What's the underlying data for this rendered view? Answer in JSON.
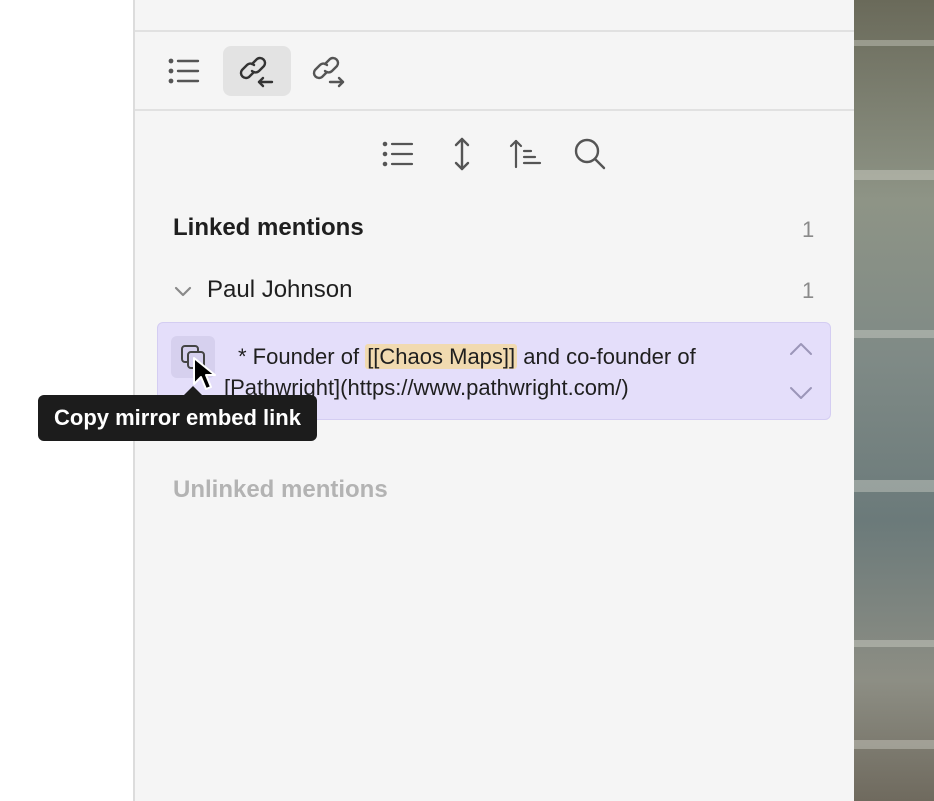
{
  "tabs": [
    {
      "icon": "outline-icon",
      "active": false
    },
    {
      "icon": "backlinks-icon",
      "active": true
    },
    {
      "icon": "outgoing-links-icon",
      "active": false
    }
  ],
  "tools": [
    "list-icon",
    "expand-collapse-icon",
    "sort-icon",
    "search-icon"
  ],
  "linked": {
    "title": "Linked mentions",
    "count": "1",
    "groups": [
      {
        "name": "Paul Johnson",
        "count": "1",
        "mention": {
          "prefix": "* Founder of ",
          "highlight": "[[Chaos Maps]]",
          "middle": " and co-founder of",
          "suffix": "[Pathwright](https://www.pathwright.com/)"
        }
      }
    ]
  },
  "unlinked": {
    "title": "Unlinked mentions"
  },
  "tooltip": {
    "text": "Copy mirror embed link"
  },
  "colors": {
    "panel": "#f5f5f5",
    "mention_bg": "#e4defa",
    "highlight": "#f1dab0",
    "tooltip_bg": "#1c1c1c"
  }
}
